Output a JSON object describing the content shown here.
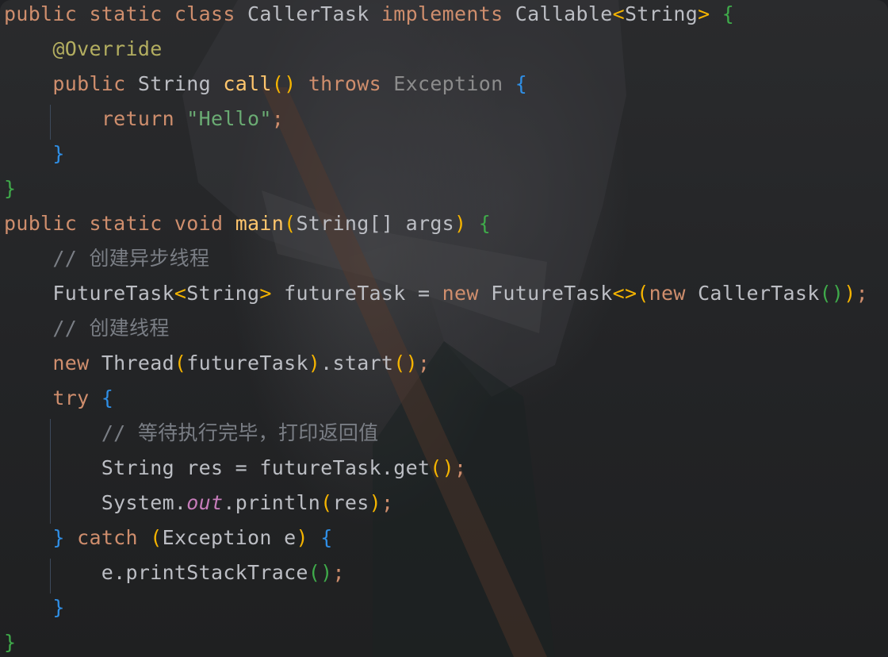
{
  "code_view": {
    "lines": [
      "public static class CallerTask implements Callable<String> {",
      "@Override",
      "public String call() throws Exception {",
      "return \"Hello\";",
      "}",
      "}",
      "public static void main(String[] args) {",
      "// 创建异步线程",
      "FutureTask<String> futureTask = new FutureTask<>(new CallerTask());",
      "// 创建线程",
      "new Thread(futureTask).start();",
      "try {",
      "// 等待执行完毕，打印返回值",
      "String res = futureTask.get();",
      "System.out.println(res);",
      "} catch (Exception e) {",
      "e.printStackTrace();",
      "}",
      "}"
    ]
  },
  "colors": {
    "keyword": "#cf8e6d",
    "identifier": "#bcbec4",
    "method": "#ffc66d",
    "annotation": "#b3ae60",
    "string": "#6aab73",
    "comment": "#7a7e85",
    "static_field": "#c77dbb",
    "bracket_level_1": "#f5b400",
    "bracket_level_2": "#3faa4a",
    "bracket_level_3": "#2f8fe6"
  }
}
